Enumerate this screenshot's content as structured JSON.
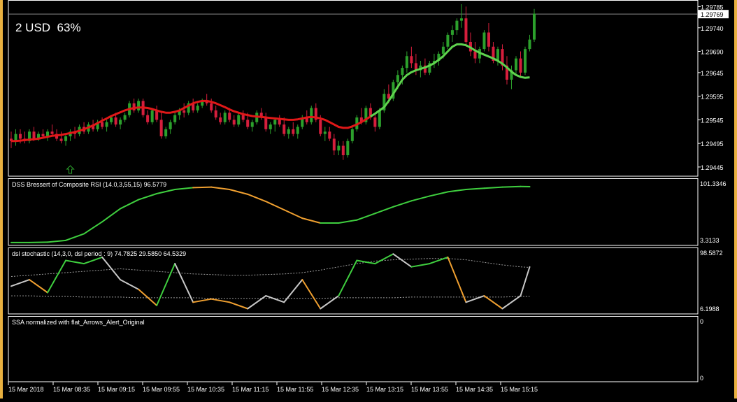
{
  "overlay": {
    "balance": "2 USD",
    "percent": "63%"
  },
  "colors": {
    "background": "#000000",
    "grid_line": "#ffffff",
    "bull_candle": "#2ca02c",
    "bear_candle": "#d61e3c",
    "ma_up": "#5fd34e",
    "ma_down": "#e01818",
    "dss_up": "#3fcf3f",
    "dss_down": "#f0a030",
    "stoch_neutral": "#c8c8c8",
    "frame": "#e8b040"
  },
  "chart_data": [
    {
      "type": "line",
      "panel": "price",
      "title": "",
      "y_ticks": [
        "1.29785",
        "1.29740",
        "1.29690",
        "1.29645",
        "1.29595",
        "1.29545",
        "1.29495",
        "1.29445"
      ],
      "ylim": [
        1.2943,
        1.2979
      ],
      "current_price": "1.29769",
      "arrow_marker": {
        "candle_index": 13,
        "direction": "up"
      },
      "candles": [
        [
          1.29505,
          1.2952,
          1.29485,
          1.295
        ],
        [
          1.295,
          1.29525,
          1.2949,
          1.29515
        ],
        [
          1.29515,
          1.29525,
          1.29495,
          1.29505
        ],
        [
          1.29505,
          1.2952,
          1.29495,
          1.295
        ],
        [
          1.295,
          1.29525,
          1.29495,
          1.2952
        ],
        [
          1.2952,
          1.2953,
          1.295,
          1.29505
        ],
        [
          1.29505,
          1.2952,
          1.295,
          1.29515
        ],
        [
          1.29515,
          1.29525,
          1.29505,
          1.2951
        ],
        [
          1.2951,
          1.29525,
          1.295,
          1.2952
        ],
        [
          1.2952,
          1.29535,
          1.2951,
          1.29515
        ],
        [
          1.29515,
          1.29525,
          1.295,
          1.29505
        ],
        [
          1.29505,
          1.2952,
          1.29495,
          1.295
        ],
        [
          1.295,
          1.29515,
          1.2949,
          1.2951
        ],
        [
          1.2951,
          1.29525,
          1.295,
          1.2952
        ],
        [
          1.2952,
          1.2953,
          1.29505,
          1.29515
        ],
        [
          1.29515,
          1.29535,
          1.2951,
          1.2953
        ],
        [
          1.2953,
          1.2954,
          1.29515,
          1.2952
        ],
        [
          1.2952,
          1.2954,
          1.29515,
          1.29535
        ],
        [
          1.29535,
          1.29545,
          1.2952,
          1.29525
        ],
        [
          1.29525,
          1.29545,
          1.2952,
          1.2954
        ],
        [
          1.2954,
          1.2955,
          1.29525,
          1.2953
        ],
        [
          1.2953,
          1.29545,
          1.2952,
          1.2954
        ],
        [
          1.2954,
          1.29555,
          1.29535,
          1.2955
        ],
        [
          1.2955,
          1.2956,
          1.2953,
          1.29535
        ],
        [
          1.29535,
          1.2955,
          1.29525,
          1.29545
        ],
        [
          1.29545,
          1.2956,
          1.2954,
          1.29555
        ],
        [
          1.29555,
          1.29585,
          1.2955,
          1.2958
        ],
        [
          1.2958,
          1.2959,
          1.2956,
          1.29565
        ],
        [
          1.29565,
          1.2959,
          1.2956,
          1.29585
        ],
        [
          1.29585,
          1.2959,
          1.2955,
          1.29555
        ],
        [
          1.29555,
          1.29565,
          1.29535,
          1.2954
        ],
        [
          1.2954,
          1.2957,
          1.29535,
          1.29565
        ],
        [
          1.29565,
          1.29575,
          1.2954,
          1.29545
        ],
        [
          1.29545,
          1.2956,
          1.29505,
          1.2951
        ],
        [
          1.2951,
          1.2953,
          1.29505,
          1.29525
        ],
        [
          1.29525,
          1.29545,
          1.29515,
          1.2954
        ],
        [
          1.2954,
          1.2956,
          1.29535,
          1.29555
        ],
        [
          1.29555,
          1.2957,
          1.29545,
          1.29565
        ],
        [
          1.29565,
          1.2958,
          1.2955,
          1.2956
        ],
        [
          1.2956,
          1.29585,
          1.29555,
          1.2958
        ],
        [
          1.2958,
          1.2959,
          1.2956,
          1.29565
        ],
        [
          1.29565,
          1.2958,
          1.2956,
          1.29575
        ],
        [
          1.29575,
          1.2959,
          1.2957,
          1.29585
        ],
        [
          1.29585,
          1.296,
          1.29575,
          1.2958
        ],
        [
          1.2958,
          1.2959,
          1.2956,
          1.29565
        ],
        [
          1.29565,
          1.29575,
          1.29545,
          1.2955
        ],
        [
          1.2955,
          1.2956,
          1.29535,
          1.2954
        ],
        [
          1.2954,
          1.29565,
          1.29535,
          1.2956
        ],
        [
          1.2956,
          1.2957,
          1.2954,
          1.29545
        ],
        [
          1.29545,
          1.29555,
          1.2953,
          1.29535
        ],
        [
          1.29535,
          1.2956,
          1.2953,
          1.29555
        ],
        [
          1.29555,
          1.29565,
          1.2954,
          1.29545
        ],
        [
          1.29545,
          1.2956,
          1.29525,
          1.2953
        ],
        [
          1.2953,
          1.29545,
          1.2952,
          1.2954
        ],
        [
          1.2954,
          1.29565,
          1.29535,
          1.2956
        ],
        [
          1.2956,
          1.2957,
          1.29545,
          1.2955
        ],
        [
          1.2955,
          1.2956,
          1.2952,
          1.29525
        ],
        [
          1.29525,
          1.2954,
          1.29515,
          1.29535
        ],
        [
          1.29535,
          1.2955,
          1.2952,
          1.29545
        ],
        [
          1.29545,
          1.29555,
          1.2953,
          1.29535
        ],
        [
          1.29535,
          1.2955,
          1.2951,
          1.29515
        ],
        [
          1.29515,
          1.2953,
          1.29505,
          1.29525
        ],
        [
          1.29525,
          1.2954,
          1.2951,
          1.29515
        ],
        [
          1.29515,
          1.29535,
          1.29505,
          1.2953
        ],
        [
          1.2953,
          1.29555,
          1.29525,
          1.2955
        ],
        [
          1.2955,
          1.29565,
          1.29535,
          1.2954
        ],
        [
          1.2954,
          1.29575,
          1.29535,
          1.2957
        ],
        [
          1.2957,
          1.2958,
          1.2954,
          1.29545
        ],
        [
          1.29545,
          1.29555,
          1.2951,
          1.29515
        ],
        [
          1.29515,
          1.2953,
          1.295,
          1.2952
        ],
        [
          1.2952,
          1.2953,
          1.295,
          1.29505
        ],
        [
          1.29505,
          1.29515,
          1.2947,
          1.2948
        ],
        [
          1.2948,
          1.295,
          1.2947,
          1.2949
        ],
        [
          1.2949,
          1.295,
          1.2946,
          1.2947
        ],
        [
          1.2947,
          1.29505,
          1.29465,
          1.295
        ],
        [
          1.295,
          1.2953,
          1.29495,
          1.29525
        ],
        [
          1.29525,
          1.29555,
          1.2952,
          1.2955
        ],
        [
          1.2955,
          1.2957,
          1.29535,
          1.2954
        ],
        [
          1.2954,
          1.29575,
          1.29535,
          1.2957
        ],
        [
          1.2957,
          1.2958,
          1.29545,
          1.2955
        ],
        [
          1.2955,
          1.29555,
          1.2952,
          1.2953
        ],
        [
          1.2953,
          1.2957,
          1.29525,
          1.29565
        ],
        [
          1.29565,
          1.2961,
          1.2956,
          1.296
        ],
        [
          1.296,
          1.2962,
          1.2958,
          1.2959
        ],
        [
          1.2959,
          1.2963,
          1.29585,
          1.29625
        ],
        [
          1.29625,
          1.2965,
          1.2961,
          1.2964
        ],
        [
          1.2964,
          1.2966,
          1.2962,
          1.29655
        ],
        [
          1.29655,
          1.2969,
          1.29645,
          1.2968
        ],
        [
          1.2968,
          1.297,
          1.29655,
          1.29665
        ],
        [
          1.29665,
          1.29685,
          1.2964,
          1.2965
        ],
        [
          1.2965,
          1.2967,
          1.29635,
          1.2966
        ],
        [
          1.2966,
          1.29675,
          1.2964,
          1.29645
        ],
        [
          1.29645,
          1.2967,
          1.2964,
          1.29665
        ],
        [
          1.29665,
          1.29685,
          1.29655,
          1.2967
        ],
        [
          1.2967,
          1.2969,
          1.2966,
          1.29685
        ],
        [
          1.29685,
          1.2971,
          1.29675,
          1.297
        ],
        [
          1.297,
          1.2973,
          1.29695,
          1.29725
        ],
        [
          1.29725,
          1.29745,
          1.2971,
          1.29735
        ],
        [
          1.29735,
          1.2976,
          1.29725,
          1.29755
        ],
        [
          1.29755,
          1.2979,
          1.2974,
          1.2976
        ],
        [
          1.2976,
          1.29785,
          1.297,
          1.2971
        ],
        [
          1.2971,
          1.2973,
          1.2968,
          1.2969
        ],
        [
          1.2969,
          1.2971,
          1.29665,
          1.29675
        ],
        [
          1.29675,
          1.297,
          1.29665,
          1.29695
        ],
        [
          1.29695,
          1.29735,
          1.2969,
          1.2973
        ],
        [
          1.2973,
          1.2975,
          1.2969,
          1.297
        ],
        [
          1.297,
          1.2971,
          1.29665,
          1.2967
        ],
        [
          1.2967,
          1.297,
          1.2966,
          1.29695
        ],
        [
          1.29695,
          1.29705,
          1.2965,
          1.2966
        ],
        [
          1.2966,
          1.2968,
          1.2962,
          1.2963
        ],
        [
          1.2963,
          1.2966,
          1.2961,
          1.2965
        ],
        [
          1.2965,
          1.2968,
          1.2964,
          1.29675
        ],
        [
          1.29675,
          1.2969,
          1.29635,
          1.29645
        ],
        [
          1.29645,
          1.297,
          1.2964,
          1.29695
        ],
        [
          1.29695,
          1.29725,
          1.2969,
          1.29715
        ],
        [
          1.29715,
          1.2978,
          1.2971,
          1.2977
        ]
      ],
      "ma_switch_index": 79,
      "ma": [
        1.295,
        1.295,
        1.29501,
        1.29502,
        1.29503,
        1.29504,
        1.29505,
        1.29507,
        1.29509,
        1.29511,
        1.29512,
        1.29513,
        1.29515,
        1.29517,
        1.29519,
        1.29522,
        1.29525,
        1.29529,
        1.29533,
        1.29538,
        1.29543,
        1.29548,
        1.29553,
        1.29557,
        1.29561,
        1.29565,
        1.29568,
        1.2957,
        1.29571,
        1.29571,
        1.2957,
        1.29568,
        1.29565,
        1.29562,
        1.2956,
        1.2956,
        1.29562,
        1.29565,
        1.2957,
        1.29575,
        1.2958,
        1.29583,
        1.29585,
        1.29585,
        1.29583,
        1.2958,
        1.29576,
        1.29572,
        1.29567,
        1.29563,
        1.2956,
        1.29557,
        1.29555,
        1.29553,
        1.29552,
        1.29551,
        1.2955,
        1.29549,
        1.29548,
        1.29547,
        1.29546,
        1.29545,
        1.29545,
        1.29546,
        1.29548,
        1.2955,
        1.29551,
        1.2955,
        1.29548,
        1.29545,
        1.2954,
        1.29535,
        1.2953,
        1.29528,
        1.29528,
        1.29531,
        1.29535,
        1.2954,
        1.29546,
        1.29552,
        1.29558,
        1.29565,
        1.29572,
        1.29585,
        1.296,
        1.29615,
        1.2963,
        1.2964,
        1.29646,
        1.2965,
        1.29653,
        1.29656,
        1.2966,
        1.29665,
        1.29672,
        1.2968,
        1.2969,
        1.297,
        1.29705,
        1.29705,
        1.29703,
        1.29698,
        1.29692,
        1.29687,
        1.29683,
        1.29679,
        1.29675,
        1.2967,
        1.29664,
        1.29656,
        1.29647,
        1.2964,
        1.29636,
        1.29634,
        1.29635
      ],
      "x_ticks": [
        "15 Mar 2018",
        "15 Mar 08:35",
        "15 Mar 09:15",
        "15 Mar 09:55",
        "15 Mar 10:35",
        "15 Mar 11:15",
        "15 Mar 11:55",
        "15 Mar 12:35",
        "15 Mar 13:15",
        "15 Mar 13:55",
        "15 Mar 14:35",
        "15 Mar 15:15"
      ]
    },
    {
      "type": "line",
      "panel": "dss",
      "title": "DSS Bressert of Composite RSI (14.0,3,55,15) 96.5779",
      "y_ticks": [
        "101.3346",
        "3.3133"
      ],
      "ylim": [
        3.3133,
        101.3346
      ],
      "x": [
        0,
        4,
        8,
        12,
        16,
        20,
        24,
        28,
        32,
        36,
        40,
        44,
        48,
        52,
        56,
        60,
        64,
        68,
        72,
        76,
        80,
        84,
        88,
        92,
        96,
        100,
        104,
        108,
        112,
        114
      ],
      "values": [
        3.5,
        3.5,
        4,
        7,
        18,
        38,
        60,
        75,
        85,
        92,
        95,
        96,
        92,
        84,
        72,
        58,
        44,
        36,
        36,
        41,
        52,
        63,
        73,
        81,
        88,
        92,
        94,
        96,
        97,
        96.6
      ],
      "colors": [
        "up",
        "up",
        "up",
        "up",
        "up",
        "up",
        "up",
        "up",
        "up",
        "up",
        "up",
        "down",
        "down",
        "down",
        "down",
        "down",
        "down",
        "down",
        "up",
        "up",
        "up",
        "up",
        "up",
        "up",
        "up",
        "up",
        "up",
        "up",
        "up",
        "up"
      ]
    },
    {
      "type": "line",
      "panel": "stochastic",
      "title": "dsl stochastic (14,3,0, dsl period : 9) 74.7825 29.5850 64.5329",
      "y_ticks": [
        "98.5872",
        "6.1988"
      ],
      "ylim": [
        6.1988,
        98.5872
      ],
      "x": [
        0,
        4,
        8,
        12,
        16,
        20,
        24,
        28,
        32,
        36,
        40,
        44,
        48,
        52,
        56,
        60,
        64,
        68,
        72,
        76,
        80,
        84,
        88,
        92,
        96,
        100,
        104,
        108,
        112,
        114
      ],
      "values": [
        45,
        55,
        35,
        85,
        80,
        90,
        55,
        40,
        15,
        80,
        20,
        25,
        20,
        10,
        30,
        20,
        55,
        10,
        30,
        85,
        80,
        95,
        75,
        80,
        90,
        20,
        30,
        10,
        30,
        74.8
      ],
      "signal_upper": [
        60,
        62,
        64,
        66,
        68,
        70,
        72,
        70,
        68,
        66,
        64,
        63,
        62,
        62,
        63,
        64,
        66,
        70,
        75,
        80,
        84,
        86,
        87,
        88,
        88,
        86,
        82,
        78,
        75,
        74
      ],
      "signal_lower": [
        30,
        30,
        29,
        29,
        28,
        28,
        28,
        27,
        27,
        27,
        27,
        26,
        26,
        26,
        26,
        26,
        26,
        26,
        27,
        27,
        27,
        27,
        28,
        28,
        28,
        28,
        28,
        28,
        29,
        29
      ],
      "colors": [
        "neutral",
        "neutral",
        "down",
        "up",
        "up",
        "up",
        "neutral",
        "neutral",
        "down",
        "up",
        "neutral",
        "down",
        "down",
        "down",
        "neutral",
        "neutral",
        "neutral",
        "down",
        "neutral",
        "up",
        "up",
        "up",
        "neutral",
        "up",
        "up",
        "down",
        "neutral",
        "down",
        "neutral",
        "neutral"
      ]
    },
    {
      "type": "line",
      "panel": "ssa",
      "title": "SSA normalized with flat_Arrows_Alert_Original",
      "y_ticks": [
        "0",
        "0"
      ],
      "values": []
    }
  ]
}
